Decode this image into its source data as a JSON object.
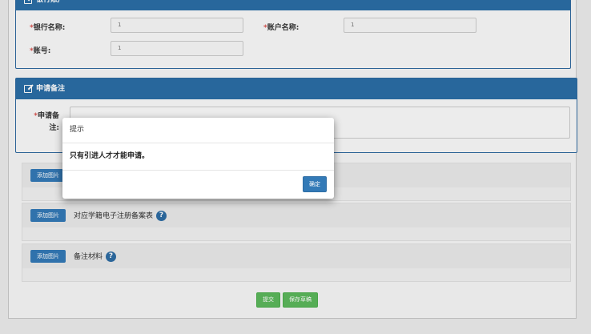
{
  "bank_panel": {
    "title": "银行账户",
    "bank_name_label": "银行名称:",
    "bank_name_value": "1",
    "account_name_label": "账户名称:",
    "account_name_value": "1",
    "account_no_label": "账号:",
    "account_no_value": "1",
    "required_mark": "*"
  },
  "remarks_panel": {
    "title": "申请备注",
    "label_line1": "申请备",
    "label_line2": "注:",
    "required_mark": "*",
    "value": ""
  },
  "attachments": [
    {
      "button": "添加图片",
      "label": ""
    },
    {
      "button": "添加图片",
      "label": "对应学籍电子注册备案表"
    },
    {
      "button": "添加图片",
      "label": "备注材料"
    }
  ],
  "help_icon_char": "?",
  "actions": {
    "submit": "提交",
    "save_draft": "保存草稿"
  },
  "dialog": {
    "title": "提示",
    "message": "只有引进人才才能申请。",
    "ok": "确定"
  },
  "colors": {
    "primary": "#337ab7",
    "panel_header": "#2b6ea6",
    "success": "#5cb85c",
    "required": "#d9534f"
  },
  "icons": {
    "panel_header": "edit-icon",
    "help": "question-circle-icon"
  }
}
